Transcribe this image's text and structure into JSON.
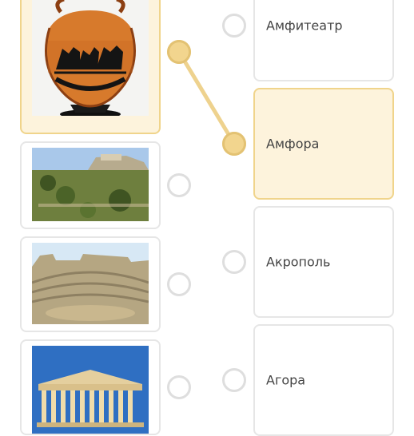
{
  "left_items": [
    {
      "name": "amphora-vase-image",
      "selected": true
    },
    {
      "name": "ancient-city-ruins-image",
      "selected": false
    },
    {
      "name": "amphitheatre-ruins-image",
      "selected": false
    },
    {
      "name": "parthenon-temple-image",
      "selected": false
    }
  ],
  "right_items": [
    {
      "label": "Амфитеатр",
      "selected": false
    },
    {
      "label": "Амфора",
      "selected": true
    },
    {
      "label": "Акрополь",
      "selected": false
    },
    {
      "label": "Агора",
      "selected": false
    }
  ],
  "colors": {
    "accent_fill": "#fdf3dc",
    "accent_border": "#f0d48b",
    "connector": "#eed28e",
    "radio_border": "#dedede",
    "card_border": "#e6e6e6",
    "text": "#444444"
  }
}
